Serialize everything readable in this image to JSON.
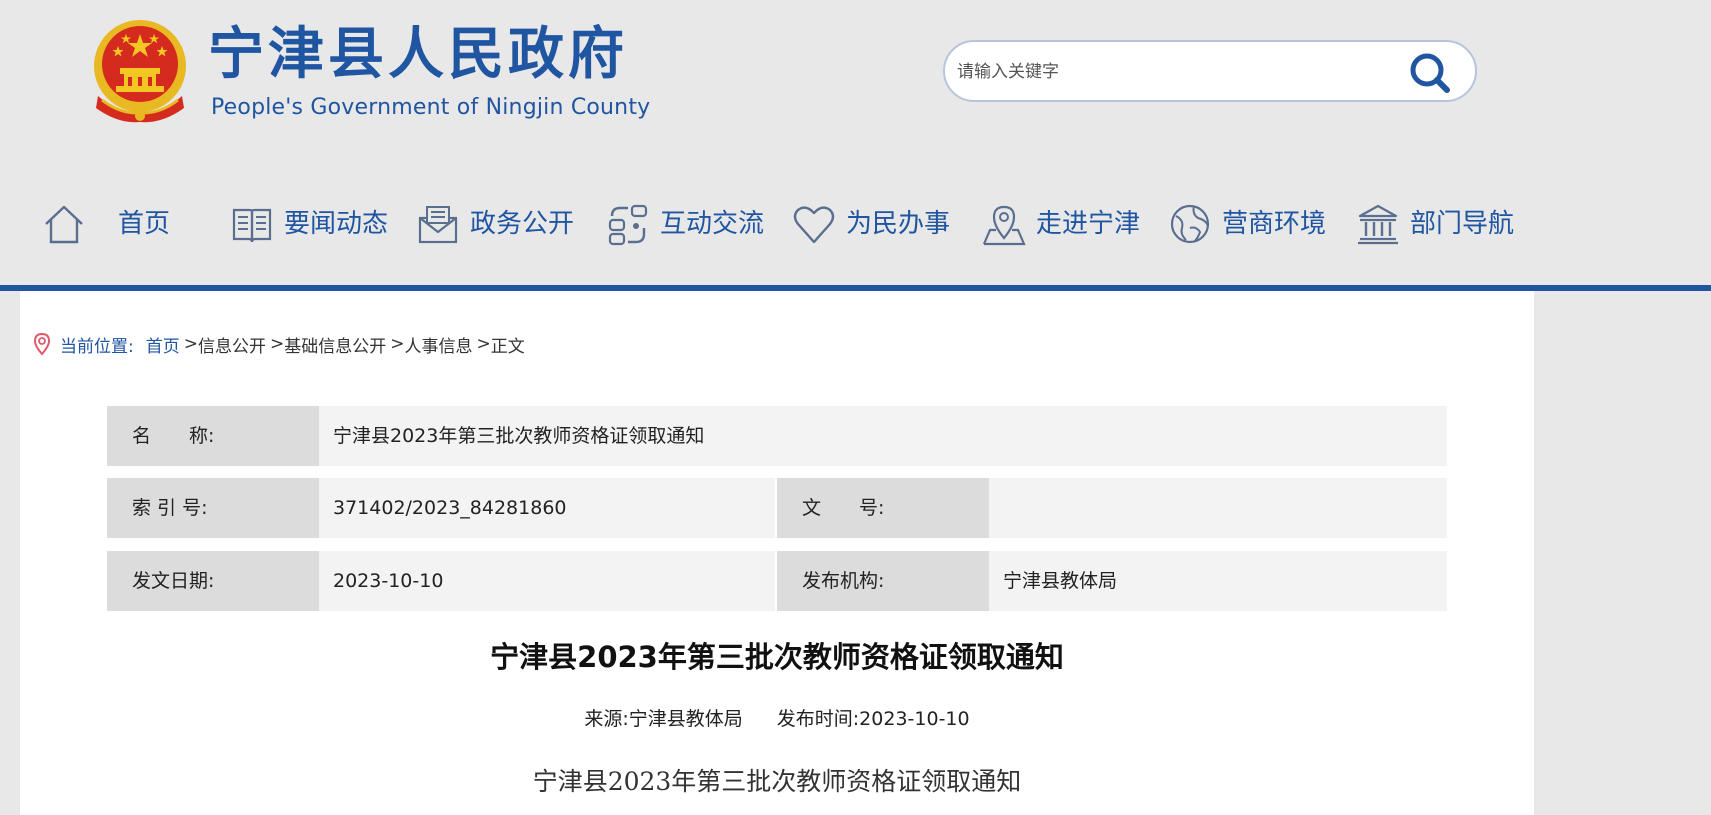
{
  "header": {
    "title_cn": "宁津县人民政府",
    "title_en": "People's Government of Ningjin County",
    "emblem_icon": "national-emblem-icon",
    "brand_color": "#1f55a1"
  },
  "search": {
    "placeholder": "请输入关键字",
    "icon": "search-icon"
  },
  "nav": {
    "items": [
      {
        "label": "首页",
        "icon": "home-icon"
      },
      {
        "label": "要闻动态",
        "icon": "news-book-icon"
      },
      {
        "label": "政务公开",
        "icon": "envelope-icon"
      },
      {
        "label": "互动交流",
        "icon": "interaction-icon"
      },
      {
        "label": "为民办事",
        "icon": "heart-icon"
      },
      {
        "label": "走进宁津",
        "icon": "map-pin-icon"
      },
      {
        "label": "营商环境",
        "icon": "globe-icon"
      },
      {
        "label": "部门导航",
        "icon": "building-icon"
      }
    ]
  },
  "breadcrumb": {
    "label": "当前位置:",
    "items": [
      "首页",
      "信息公开",
      "基础信息公开",
      "人事信息",
      "正文"
    ],
    "separator": ">"
  },
  "meta": {
    "name_label": "名　　称:",
    "name_value": "宁津县2023年第三批次教师资格证领取通知",
    "index_label": "索 引 号:",
    "index_value": "371402/2023_84281860",
    "docno_label": "文　　号:",
    "docno_value": "",
    "date_label": "发文日期:",
    "date_value": "2023-10-10",
    "org_label": "发布机构:",
    "org_value": "宁津县教体局"
  },
  "article": {
    "title": "宁津县2023年第三批次教师资格证领取通知",
    "source": "来源:宁津县教体局",
    "publish_time": "发布时间:2023-10-10",
    "body_title": "宁津县2023年第三批次教师资格证领取通知"
  }
}
